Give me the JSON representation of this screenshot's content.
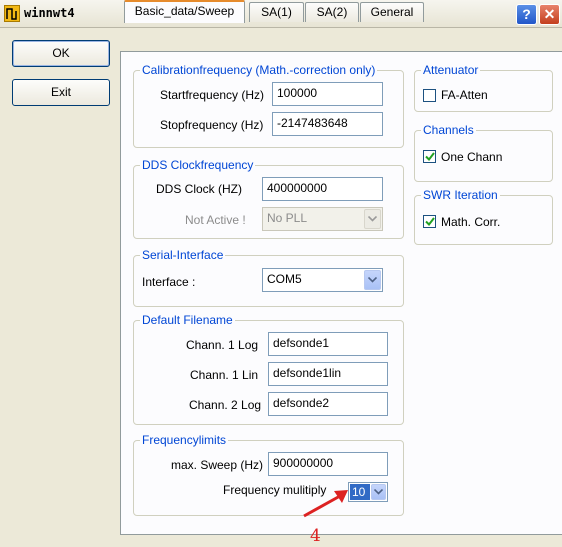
{
  "window": {
    "title": "winnwt4",
    "help_glyph": "?",
    "close_glyph": "✕"
  },
  "buttons": {
    "ok": "OK",
    "exit": "Exit"
  },
  "tabs": [
    "Basic_data/Sweep",
    "SA(1)",
    "SA(2)",
    "General"
  ],
  "calibration": {
    "title": "Calibrationfrequency (Math.-correction only)",
    "start_label": "Startfrequency (Hz)",
    "start_value": "100000",
    "stop_label": "Stopfrequency (Hz)",
    "stop_value": "-2147483648"
  },
  "dds": {
    "title": "DDS Clockfrequency",
    "clock_label": "DDS Clock (HZ)",
    "clock_value": "400000000",
    "notactive_label": "Not Active !",
    "pll_value": "No PLL"
  },
  "serial": {
    "title": "Serial-Interface",
    "interface_label": "Interface :",
    "interface_value": "COM5"
  },
  "filename": {
    "title": "Default Filename",
    "rows": [
      {
        "label": "Chann. 1  Log",
        "value": "defsonde1"
      },
      {
        "label": "Chann. 1  Lin",
        "value": "defsonde1lin"
      },
      {
        "label": "Chann. 2 Log",
        "value": "defsonde2"
      }
    ]
  },
  "freqlimits": {
    "title": "Frequencylimits",
    "max_label": "max. Sweep (Hz)",
    "max_value": "900000000",
    "mult_label": "Frequency mulitiply",
    "mult_value": "10"
  },
  "attenuator": {
    "title": "Attenuator",
    "fa_label": "FA-Atten",
    "fa_checked": false
  },
  "channels": {
    "title": "Channels",
    "one_label": "One Chann",
    "one_checked": true
  },
  "swr": {
    "title": "SWR Iteration",
    "math_label": "Math. Corr.",
    "math_checked": true
  },
  "annotation": {
    "number": "4",
    "color": "#d22222"
  }
}
